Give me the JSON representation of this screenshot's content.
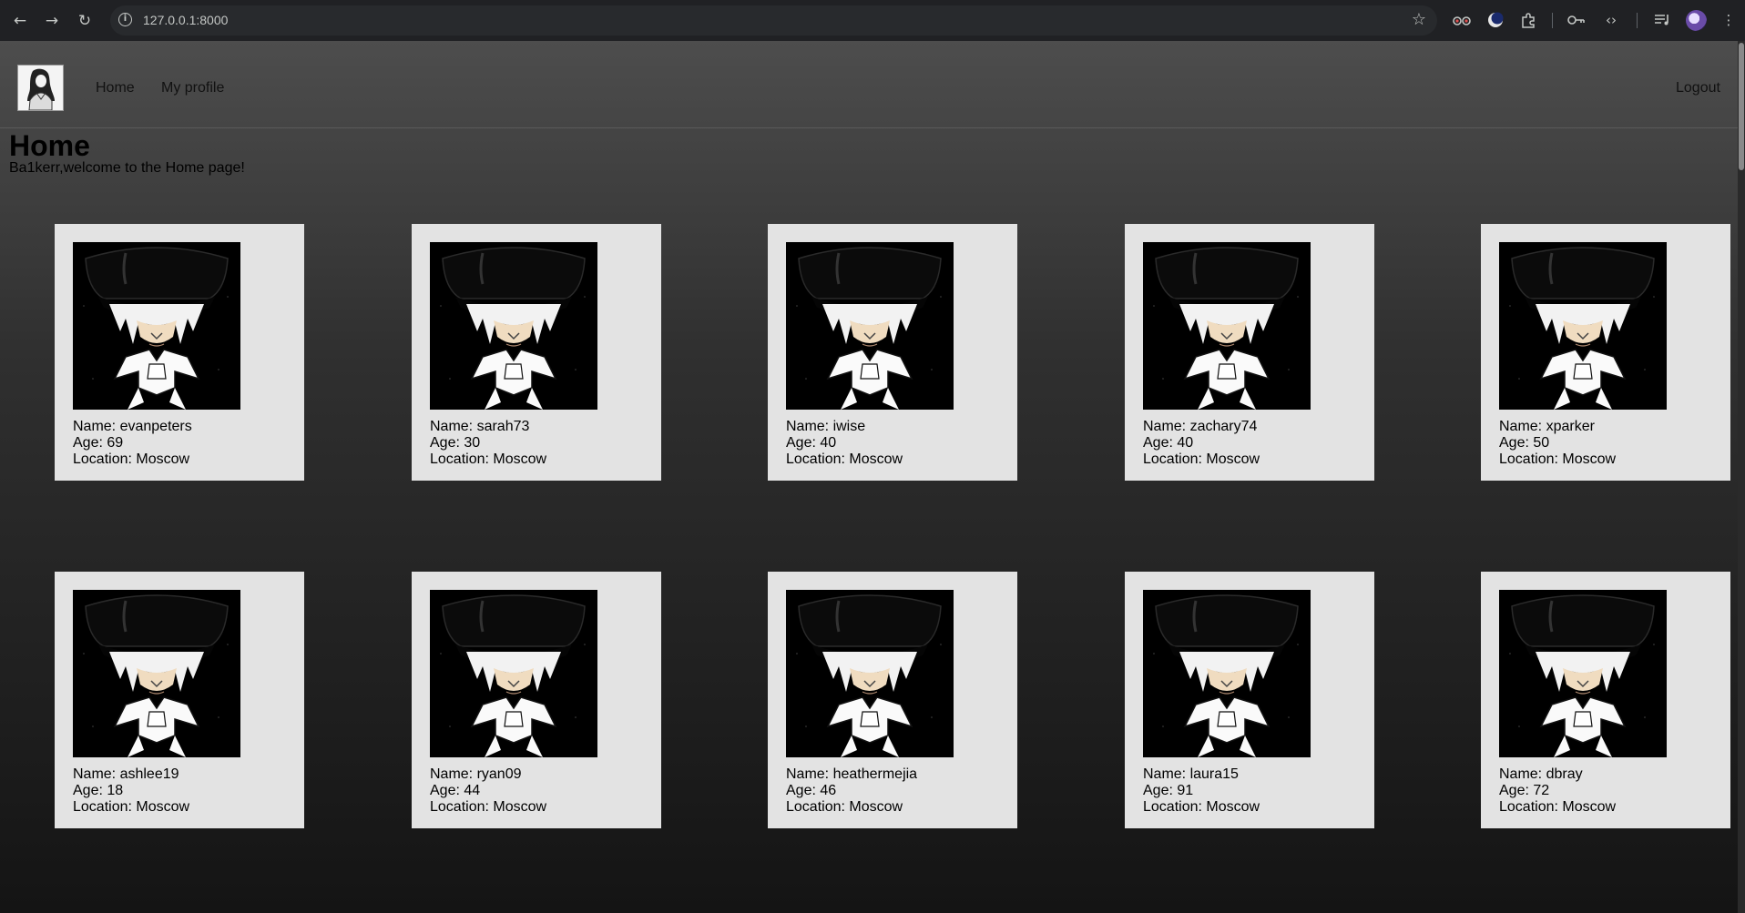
{
  "browser": {
    "url": "127.0.0.1:8000"
  },
  "navbar": {
    "home_label": "Home",
    "profile_label": "My profile",
    "logout_label": "Logout"
  },
  "main": {
    "title": "Home",
    "welcome": "Ba1kerr,welcome to the Home page!"
  },
  "users": [
    {
      "name": "Name: evanpeters",
      "age": "Age: 69",
      "location": "Location: Moscow"
    },
    {
      "name": "Name: sarah73",
      "age": "Age: 30",
      "location": "Location: Moscow"
    },
    {
      "name": "Name: iwise",
      "age": "Age: 40",
      "location": "Location: Moscow"
    },
    {
      "name": "Name: zachary74",
      "age": "Age: 40",
      "location": "Location: Moscow"
    },
    {
      "name": "Name: xparker",
      "age": "Age: 50",
      "location": "Location: Moscow"
    },
    {
      "name": "Name: ashlee19",
      "age": "Age: 18",
      "location": "Location: Moscow"
    },
    {
      "name": "Name: ryan09",
      "age": "Age: 44",
      "location": "Location: Moscow"
    },
    {
      "name": "Name: heathermejia",
      "age": "Age: 46",
      "location": "Location: Moscow"
    },
    {
      "name": "Name: laura15",
      "age": "Age: 91",
      "location": "Location: Moscow"
    },
    {
      "name": "Name: dbray",
      "age": "Age: 72",
      "location": "Location: Moscow"
    }
  ]
}
